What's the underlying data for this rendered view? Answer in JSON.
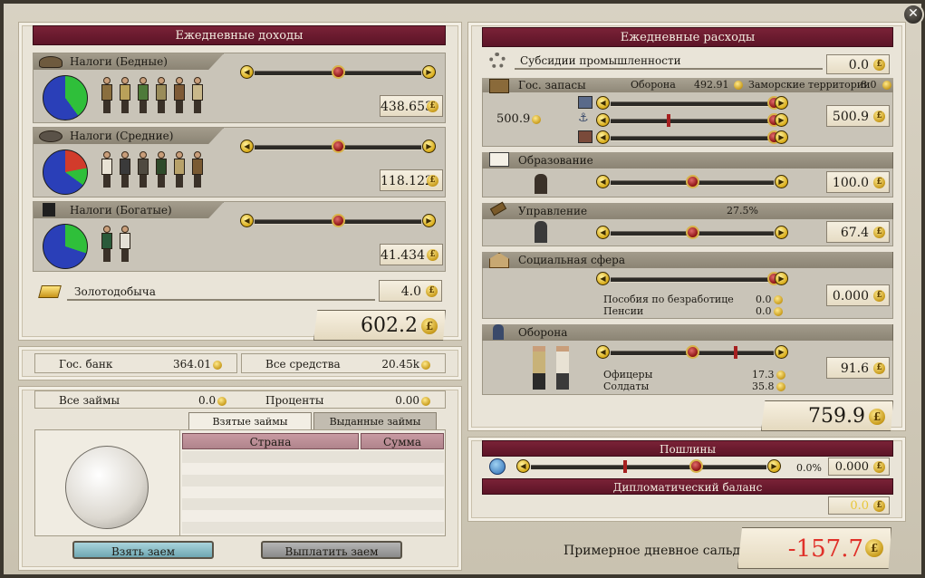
{
  "income": {
    "title": "Ежедневные доходы",
    "taxes_poor": {
      "label": "Налоги (Бедные)",
      "value": "438.653",
      "rate_pct": 50
    },
    "taxes_middle": {
      "label": "Налоги (Средние)",
      "value": "118.122",
      "rate_pct": 50
    },
    "taxes_rich": {
      "label": "Налоги (Богатые)",
      "value": "41.434",
      "rate_pct": 50
    },
    "gold": {
      "label": "Золотодобыча",
      "value": "4.0"
    },
    "total": "602.2"
  },
  "bank": {
    "state_bank_label": "Гос. банк",
    "state_bank_value": "364.01",
    "total_funds_label": "Все средства",
    "total_funds_value": "20.45k"
  },
  "loans": {
    "all_loans_label": "Все займы",
    "all_loans_value": "0.0",
    "interest_label": "Проценты",
    "interest_value": "0.00",
    "tab_taken": "Взятые займы",
    "tab_given": "Выданные займы",
    "col_country": "Страна",
    "col_sum": "Сумма",
    "take_button": "Взять заем",
    "repay_button": "Выплатить заем"
  },
  "expenses": {
    "title": "Ежедневные расходы",
    "subsidies": {
      "label": "Субсидии промышленности",
      "value": "0.0"
    },
    "stockpile": {
      "label": "Гос. запасы",
      "defense_label": "Оборона",
      "defense_value": "492.91",
      "overseas_label": "Заморские территории",
      "overseas_value": "8.0",
      "left_value": "500.9",
      "value": "500.9",
      "slider1_pct": 100,
      "slider2_pct": 100,
      "slider3_pct": 100
    },
    "education": {
      "label": "Образование",
      "value": "100.0",
      "rate_pct": 50
    },
    "administration": {
      "label": "Управление",
      "percent": "27.5%",
      "value": "67.4",
      "rate_pct": 50
    },
    "social": {
      "label": "Социальная сфера",
      "value": "0.000",
      "rate_pct": 100,
      "unemployment_label": "Пособия по безработице",
      "unemployment_value": "0.0",
      "pensions_label": "Пенсии",
      "pensions_value": "0.0"
    },
    "military": {
      "label": "Оборона",
      "value": "91.6",
      "rate_pct": 50,
      "officers_label": "Офицеры",
      "officers_value": "17.3",
      "soldiers_label": "Солдаты",
      "soldiers_value": "35.8"
    },
    "total": "759.9"
  },
  "tariffs": {
    "title": "Пошлины",
    "percent": "0.0%",
    "value": "0.000",
    "rate_pct": 70,
    "diplomatic_label": "Дипломатический баланс",
    "diplomatic_value": "0.0"
  },
  "balance": {
    "label": "Примерное дневное сальдо",
    "value": "-157.7"
  },
  "colors": {
    "banner": "#6a1a2f",
    "negative": "#e0312a",
    "pie_green": "#2fbf3a",
    "pie_blue": "#2a3fb8",
    "pie_red": "#d23b2b"
  }
}
